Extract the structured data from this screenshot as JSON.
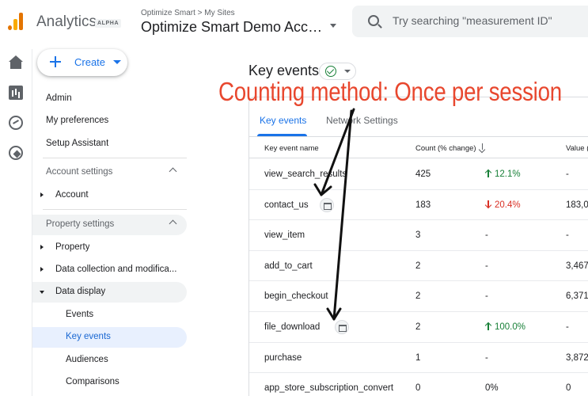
{
  "header": {
    "brand": "Analytics",
    "badge": "ALPHA",
    "breadcrumb": "Optimize Smart > My Sites",
    "account_name": "Optimize Smart Demo Acco...",
    "search_placeholder": "Try searching \"measurement ID\""
  },
  "rail": {
    "icons": [
      "home-icon",
      "reports-icon",
      "explore-icon",
      "advertising-icon"
    ]
  },
  "sidebar": {
    "create_label": "Create",
    "items": {
      "admin": "Admin",
      "my_preferences": "My preferences",
      "setup_assistant": "Setup Assistant",
      "account_settings": "Account settings",
      "account": "Account",
      "property_settings": "Property settings",
      "property": "Property",
      "data_collection": "Data collection and modifica...",
      "data_display": "Data display",
      "events": "Events",
      "key_events": "Key events",
      "audiences": "Audiences",
      "comparisons": "Comparisons"
    }
  },
  "main": {
    "title": "Key events",
    "tabs": [
      "Key events",
      "Network Settings"
    ],
    "columns": {
      "name": "Key event name",
      "count": "Count (% change)",
      "value": "Value ("
    },
    "rows": [
      {
        "name": "view_search_results",
        "count": "425",
        "change": "12.1%",
        "trend": "up",
        "value": "-",
        "session_icon": false
      },
      {
        "name": "contact_us",
        "count": "183",
        "change": "20.4%",
        "trend": "down",
        "value": "183,0",
        "session_icon": true
      },
      {
        "name": "view_item",
        "count": "3",
        "change": "-",
        "trend": "none",
        "value": "-",
        "session_icon": false
      },
      {
        "name": "add_to_cart",
        "count": "2",
        "change": "-",
        "trend": "none",
        "value": "3,467",
        "session_icon": false
      },
      {
        "name": "begin_checkout",
        "count": "2",
        "change": "-",
        "trend": "none",
        "value": "6,371",
        "session_icon": false
      },
      {
        "name": "file_download",
        "count": "2",
        "change": "100.0%",
        "trend": "up",
        "value": "-",
        "session_icon": true
      },
      {
        "name": "purchase",
        "count": "1",
        "change": "-",
        "trend": "none",
        "value": "3,872",
        "session_icon": false
      },
      {
        "name": "app_store_subscription_convert",
        "count": "0",
        "change": "0%",
        "trend": "none",
        "value": "0",
        "session_icon": false
      }
    ]
  },
  "annotation": {
    "text": "Counting method: Once per session",
    "color": "#e8472e"
  },
  "colors": {
    "accent": "#1a73e8",
    "positive": "#188038",
    "negative": "#d93025",
    "active_bg": "#e8f0fe"
  }
}
